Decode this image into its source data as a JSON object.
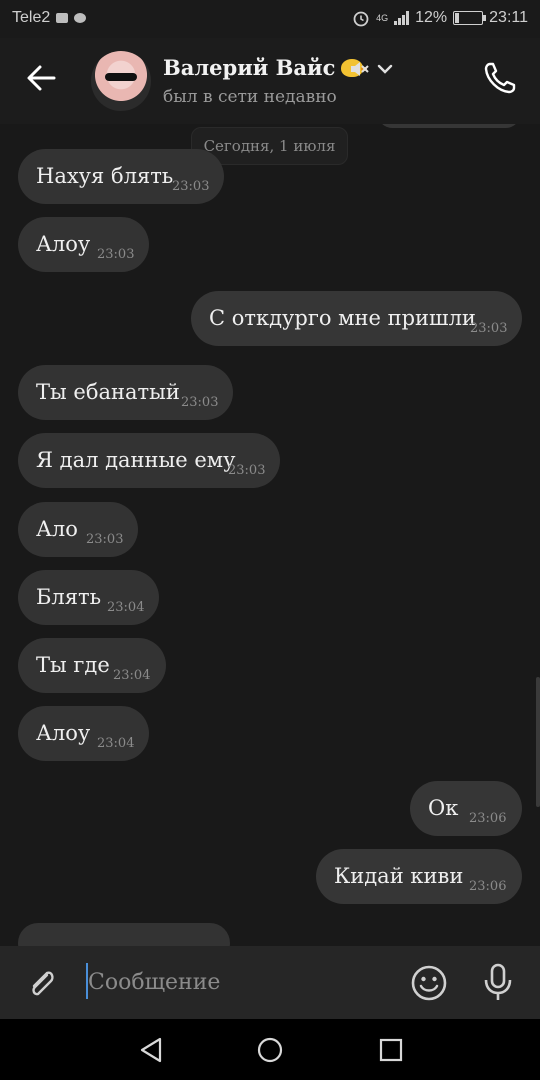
{
  "status_bar": {
    "carrier": "Tele2",
    "battery": "12%",
    "battery_fraction": 0.12,
    "time": "23:11",
    "network": "4G"
  },
  "header": {
    "contact_name": "Валерий Вайс",
    "last_seen": "был в сети недавно",
    "icons": {
      "back": "arrow-left-icon",
      "mute": "muted-speaker-icon",
      "menu": "chevron-down-icon",
      "call": "phone-icon"
    }
  },
  "chat": {
    "date_chip": "Сегодня, 1 июля",
    "messages": [
      {
        "direction": "in",
        "text": "Нахуя блять",
        "time": "23:03"
      },
      {
        "direction": "in",
        "text": "Алоу",
        "time": "23:03"
      },
      {
        "direction": "out",
        "text": "С откдурго мне пришли",
        "time": "23:03"
      },
      {
        "direction": "in",
        "text": "Ты ебанатый",
        "time": "23:03"
      },
      {
        "direction": "in",
        "text": "Я дал данные ему",
        "time": "23:03"
      },
      {
        "direction": "in",
        "text": "Ало",
        "time": "23:03"
      },
      {
        "direction": "in",
        "text": "Блять",
        "time": "23:04"
      },
      {
        "direction": "in",
        "text": "Ты где",
        "time": "23:04"
      },
      {
        "direction": "in",
        "text": "Алоу",
        "time": "23:04"
      },
      {
        "direction": "out",
        "text": "Ок",
        "time": "23:06"
      },
      {
        "direction": "out",
        "text": "Кидай киви",
        "time": "23:06"
      }
    ]
  },
  "composer": {
    "placeholder": "Сообщение",
    "value": "",
    "icons": {
      "attach": "paperclip-icon",
      "emoji": "smiley-icon",
      "voice": "microphone-icon"
    }
  },
  "navigation": {
    "icons": {
      "back": "triangle-back-icon",
      "home": "circle-home-icon",
      "recents": "square-recents-icon"
    }
  }
}
